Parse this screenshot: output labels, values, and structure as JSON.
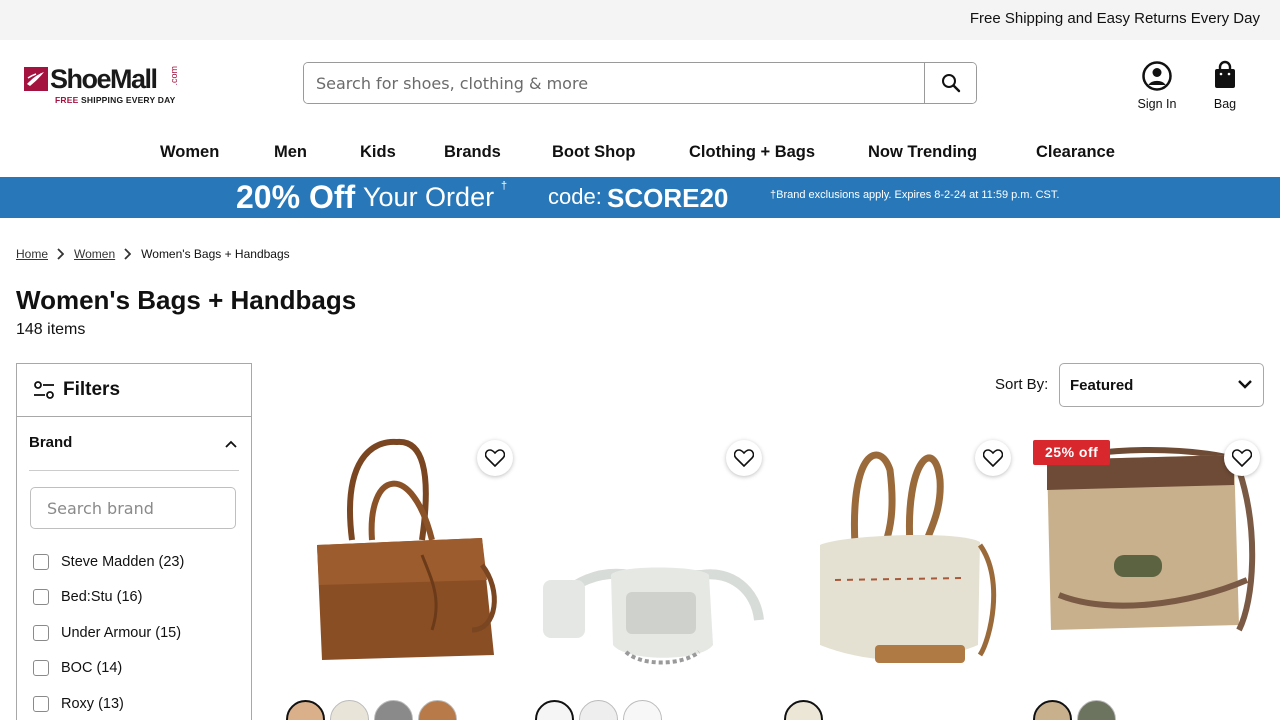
{
  "topbar": {
    "text": "Free Shipping and Easy Returns Every Day"
  },
  "logo": {
    "word": "ShoeMall",
    "com": ".com",
    "tag_free": "FREE",
    "tag_rest": " SHIPPING EVERY DAY"
  },
  "search": {
    "placeholder": "Search for shoes, clothing & more",
    "value": "",
    "icon": "search-icon"
  },
  "header": {
    "sign_in": "Sign In",
    "bag": "Bag"
  },
  "nav": [
    "Women",
    "Men",
    "Kids",
    "Brands",
    "Boot Shop",
    "Clothing + Bags",
    "Now Trending",
    "Clearance"
  ],
  "promo": {
    "headline_bold": "20% Off",
    "headline_rest": "Your Order",
    "dagger": "†",
    "code_label": "code:",
    "code": "SCORE20",
    "fine_print": "†Brand exclusions apply. Expires 8-2-24 at 11:59 p.m. CST.",
    "bg_color": "#2878b9"
  },
  "breadcrumb": {
    "home": "Home",
    "women": "Women",
    "current": "Women's Bags + Handbags"
  },
  "page": {
    "title": "Women's Bags + Handbags",
    "count": "148 items"
  },
  "filters": {
    "title": "Filters",
    "brand_label": "Brand",
    "brand_search_placeholder": "Search brand",
    "brands": [
      "Steve Madden (23)",
      "Bed:Stu (16)",
      "Under Armour (15)",
      "BOC (14)",
      "Roxy (13)"
    ]
  },
  "sort": {
    "label": "Sort By:",
    "value": "Featured"
  },
  "products": [
    {
      "badge": "",
      "swatch_count": 4
    },
    {
      "badge": "",
      "swatch_count": 3
    },
    {
      "badge": "",
      "swatch_count": 1
    },
    {
      "badge": "25% off",
      "swatch_count": 2
    }
  ],
  "colors": {
    "brand_red": "#a4123f",
    "sale_red": "#d9272e"
  }
}
